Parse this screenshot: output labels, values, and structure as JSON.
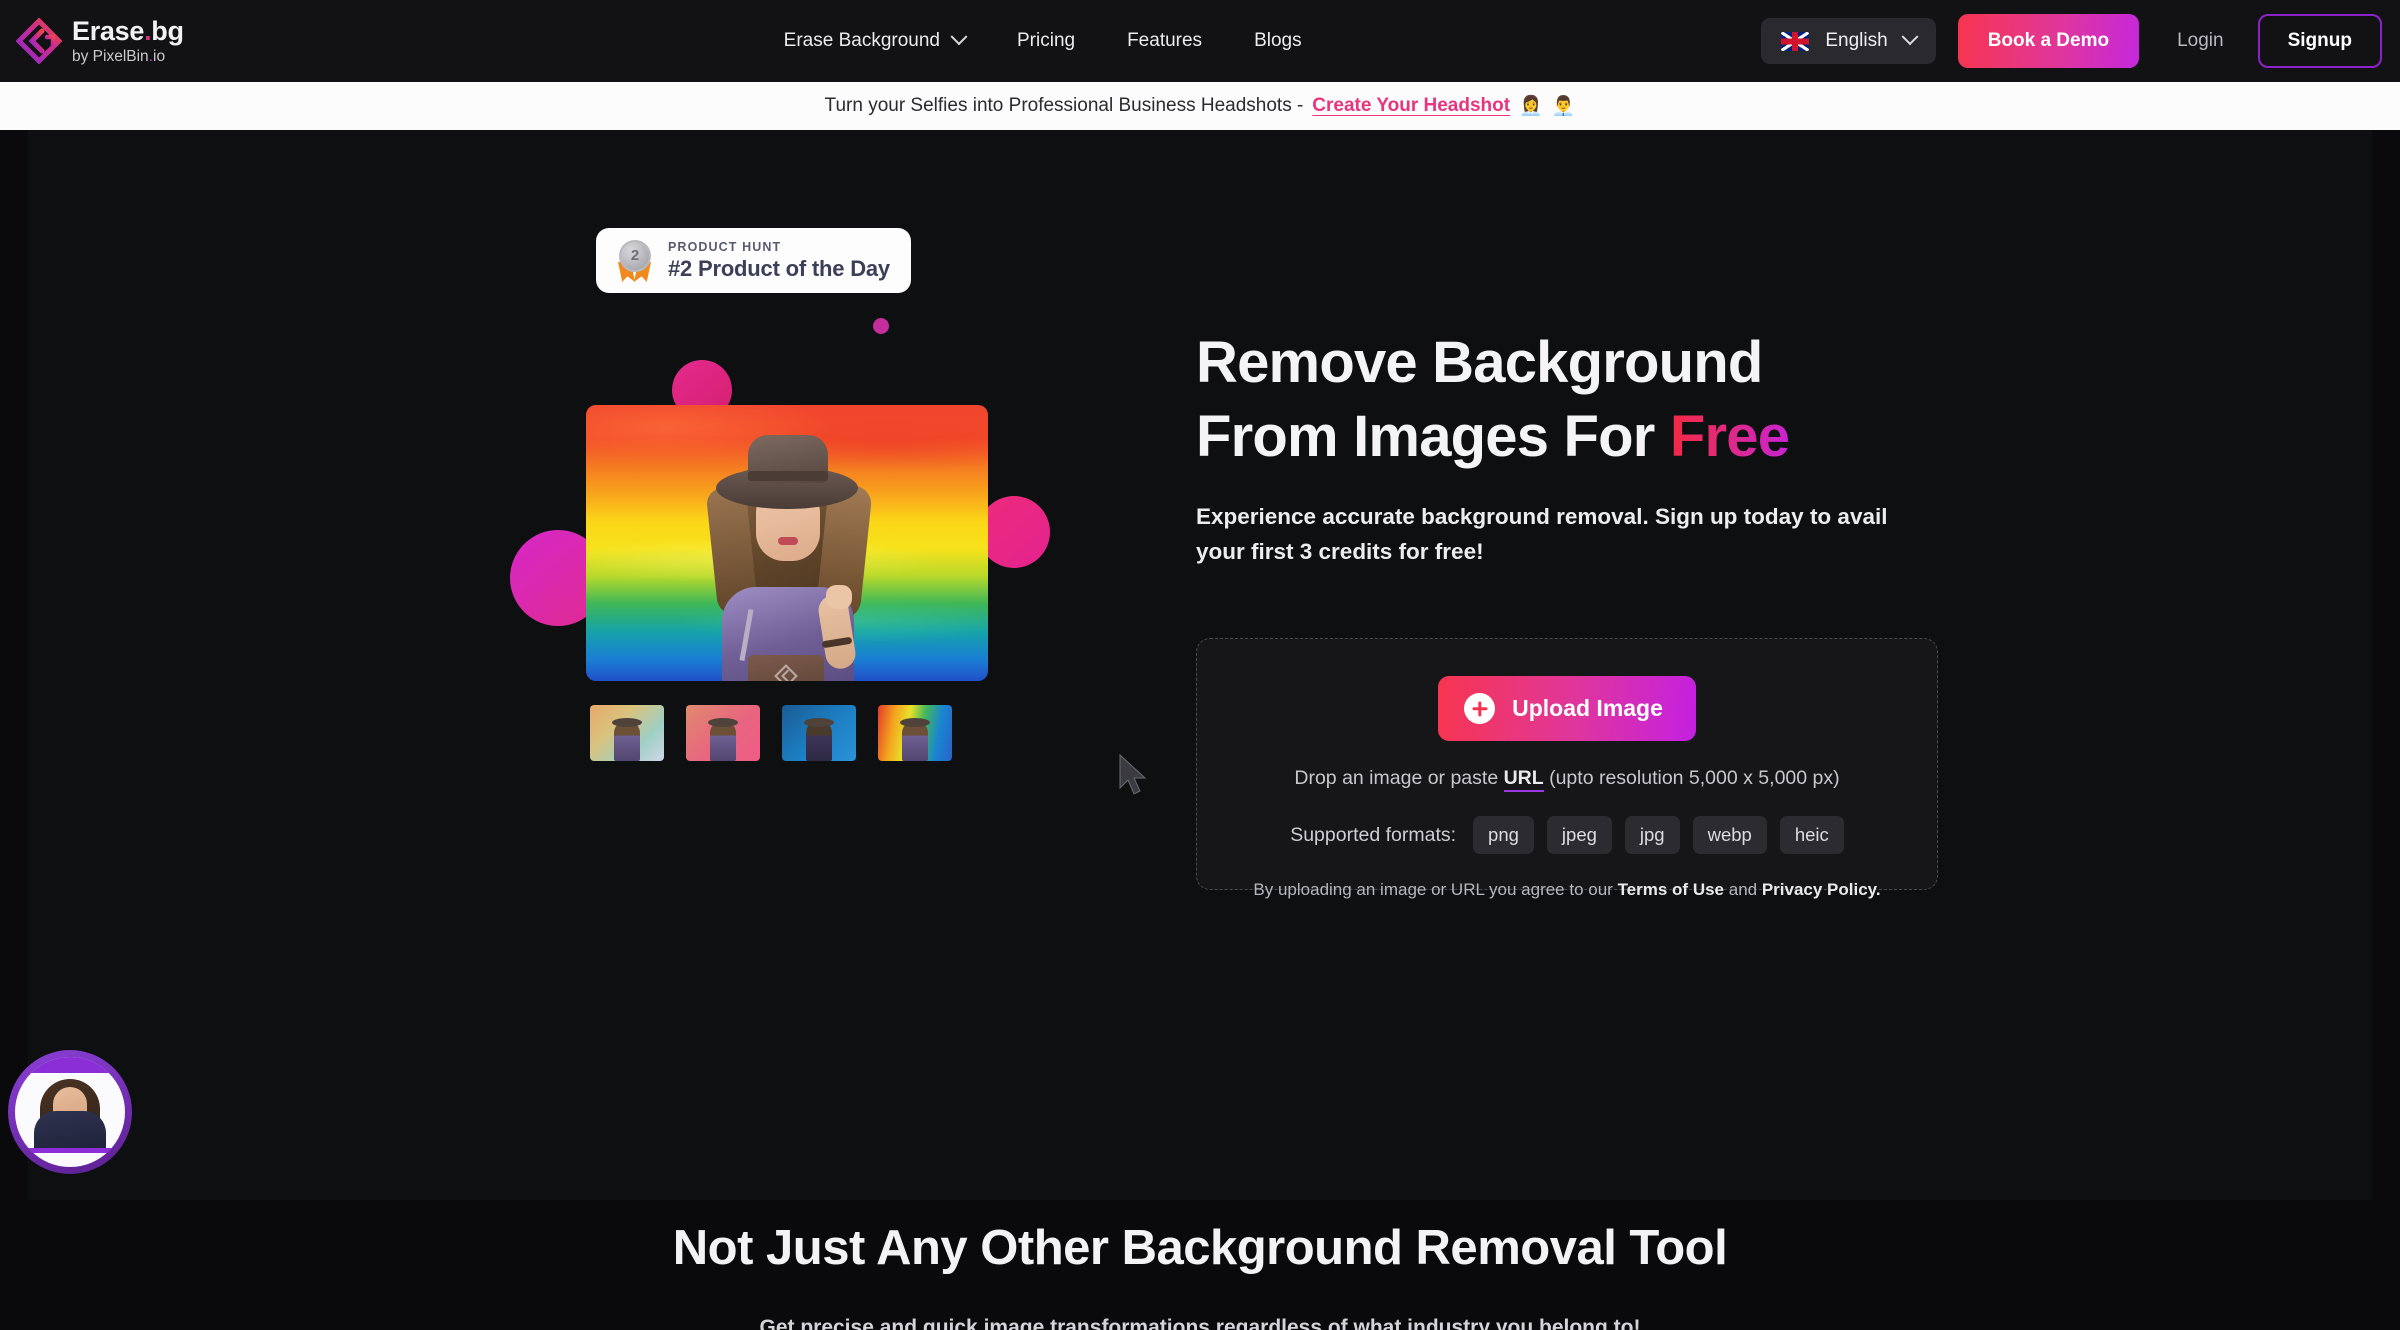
{
  "brand": {
    "name": "Erase",
    "name_dot": ".",
    "name_suffix": "bg",
    "byline_prefix": "by PixelBin",
    "byline_dot": ".",
    "byline_suffix": "io",
    "logo_icon": "erasebg-diamond-logo-icon"
  },
  "nav": {
    "links": [
      {
        "label": "Erase Background",
        "has_dropdown": true,
        "icon": "chevron-down-icon"
      },
      {
        "label": "Pricing",
        "has_dropdown": false
      },
      {
        "label": "Features",
        "has_dropdown": false
      },
      {
        "label": "Blogs",
        "has_dropdown": false
      }
    ],
    "language": {
      "label": "English",
      "flag_icon": "uk-flag-icon",
      "chevron_icon": "chevron-down-icon"
    },
    "demo_button": "Book a Demo",
    "login_link": "Login",
    "signup_button": "Signup"
  },
  "banner": {
    "text": "Turn your Selfies into Professional Business Headshots - ",
    "link": "Create Your Headshot",
    "emoji_1": "👩‍💼",
    "emoji_2": "👨‍💼"
  },
  "hero": {
    "product_hunt": {
      "kicker": "PRODUCT HUNT",
      "title": "#2 Product of the Day",
      "medal_rank": "2",
      "medal_icon": "product-hunt-medal-icon"
    },
    "headline_line1": "Remove Background",
    "headline_line2_prefix": "From Images For ",
    "headline_highlight": "Free",
    "subhead": "Experience accurate background removal. Sign up today to avail your first 3 credits for free!",
    "hero_image_alt": "woman-with-hat-rainbow-background",
    "thumbnails": [
      {
        "name": "thumbnail-gradient-pastel"
      },
      {
        "name": "thumbnail-pink-backdrop"
      },
      {
        "name": "thumbnail-blue-backdrop"
      },
      {
        "name": "thumbnail-rainbow-backdrop"
      }
    ]
  },
  "upload": {
    "button_label": "Upload Image",
    "button_icon": "plus-circle-icon",
    "drop_text_before": "Drop an image or paste ",
    "drop_link": "URL",
    "drop_text_after": " (upto resolution 5,000 x 5,000 px)",
    "formats_label": "Supported formats:",
    "formats": [
      "png",
      "jpeg",
      "jpg",
      "webp",
      "heic"
    ],
    "legal_before": "By uploading an image or URL you agree to our ",
    "legal_terms": "Terms of Use",
    "legal_and": " and ",
    "legal_privacy": "Privacy Policy.",
    "gradient_start": "#F7354F",
    "gradient_end": "#C420E2"
  },
  "section": {
    "heading": "Not Just Any Other Background Removal Tool",
    "subheading": "Get precise and quick image transformations regardless of what industry you belong to!"
  },
  "widget": {
    "avatar_alt": "video-chat-avatar"
  },
  "colors": {
    "page_background": "#0E0F11",
    "nav_background": "#121215",
    "banner_background": "#FCFCFD",
    "accent_pink": "#E8357F",
    "accent_purple": "#8B23C9"
  }
}
